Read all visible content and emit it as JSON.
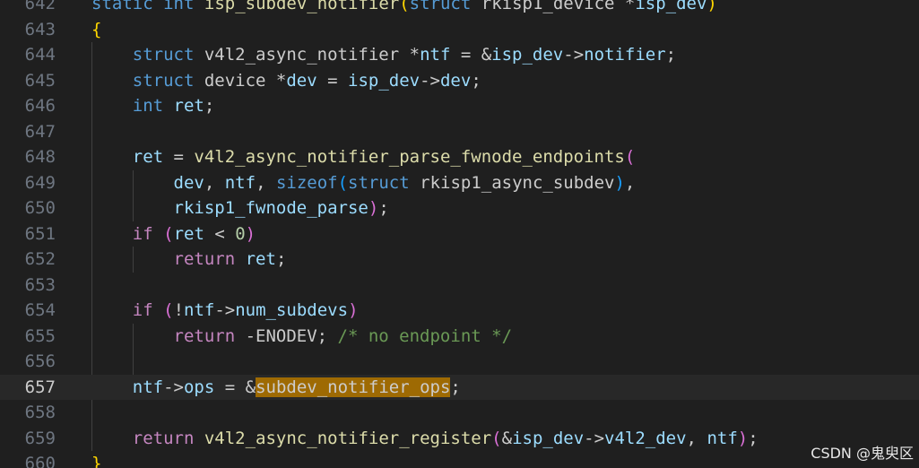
{
  "editor": {
    "current_line": "657",
    "lines": [
      {
        "num": "642",
        "tokens": [
          {
            "t": "kw",
            "v": "static"
          },
          {
            "t": "plain",
            "v": " "
          },
          {
            "t": "kw",
            "v": "int"
          },
          {
            "t": "plain",
            "v": " "
          },
          {
            "t": "fn",
            "v": "isp_subdev_notifier"
          },
          {
            "t": "b1",
            "v": "("
          },
          {
            "t": "kw",
            "v": "struct"
          },
          {
            "t": "plain",
            "v": " rkisp1_device *"
          },
          {
            "t": "var",
            "v": "isp_dev"
          },
          {
            "t": "b1",
            "v": ")"
          }
        ]
      },
      {
        "num": "643",
        "tokens": [
          {
            "t": "b1",
            "v": "{"
          }
        ]
      },
      {
        "num": "644",
        "tokens": [
          {
            "t": "plain",
            "v": "    "
          },
          {
            "t": "kw",
            "v": "struct"
          },
          {
            "t": "plain",
            "v": " v4l2_async_notifier *"
          },
          {
            "t": "var",
            "v": "ntf"
          },
          {
            "t": "plain",
            "v": " = &"
          },
          {
            "t": "var",
            "v": "isp_dev"
          },
          {
            "t": "plain",
            "v": "->"
          },
          {
            "t": "prop",
            "v": "notifier"
          },
          {
            "t": "plain",
            "v": ";"
          }
        ]
      },
      {
        "num": "645",
        "tokens": [
          {
            "t": "plain",
            "v": "    "
          },
          {
            "t": "kw",
            "v": "struct"
          },
          {
            "t": "plain",
            "v": " device *"
          },
          {
            "t": "var",
            "v": "dev"
          },
          {
            "t": "plain",
            "v": " = "
          },
          {
            "t": "var",
            "v": "isp_dev"
          },
          {
            "t": "plain",
            "v": "->"
          },
          {
            "t": "prop",
            "v": "dev"
          },
          {
            "t": "plain",
            "v": ";"
          }
        ]
      },
      {
        "num": "646",
        "tokens": [
          {
            "t": "plain",
            "v": "    "
          },
          {
            "t": "kw",
            "v": "int"
          },
          {
            "t": "plain",
            "v": " "
          },
          {
            "t": "var",
            "v": "ret"
          },
          {
            "t": "plain",
            "v": ";"
          }
        ]
      },
      {
        "num": "647",
        "tokens": []
      },
      {
        "num": "648",
        "tokens": [
          {
            "t": "plain",
            "v": "    "
          },
          {
            "t": "var",
            "v": "ret"
          },
          {
            "t": "plain",
            "v": " = "
          },
          {
            "t": "fn",
            "v": "v4l2_async_notifier_parse_fwnode_endpoints"
          },
          {
            "t": "b2",
            "v": "("
          }
        ]
      },
      {
        "num": "649",
        "tokens": [
          {
            "t": "plain",
            "v": "        "
          },
          {
            "t": "var",
            "v": "dev"
          },
          {
            "t": "plain",
            "v": ", "
          },
          {
            "t": "var",
            "v": "ntf"
          },
          {
            "t": "plain",
            "v": ", "
          },
          {
            "t": "kw",
            "v": "sizeof"
          },
          {
            "t": "b3",
            "v": "("
          },
          {
            "t": "kw",
            "v": "struct"
          },
          {
            "t": "plain",
            "v": " rkisp1_async_subdev"
          },
          {
            "t": "b3",
            "v": ")"
          },
          {
            "t": "plain",
            "v": ","
          }
        ]
      },
      {
        "num": "650",
        "tokens": [
          {
            "t": "plain",
            "v": "        "
          },
          {
            "t": "var",
            "v": "rkisp1_fwnode_parse"
          },
          {
            "t": "b2",
            "v": ")"
          },
          {
            "t": "plain",
            "v": ";"
          }
        ]
      },
      {
        "num": "651",
        "tokens": [
          {
            "t": "plain",
            "v": "    "
          },
          {
            "t": "ctrl",
            "v": "if"
          },
          {
            "t": "plain",
            "v": " "
          },
          {
            "t": "b2",
            "v": "("
          },
          {
            "t": "var",
            "v": "ret"
          },
          {
            "t": "plain",
            "v": " < "
          },
          {
            "t": "num",
            "v": "0"
          },
          {
            "t": "b2",
            "v": ")"
          }
        ]
      },
      {
        "num": "652",
        "tokens": [
          {
            "t": "plain",
            "v": "        "
          },
          {
            "t": "ctrl",
            "v": "return"
          },
          {
            "t": "plain",
            "v": " "
          },
          {
            "t": "var",
            "v": "ret"
          },
          {
            "t": "plain",
            "v": ";"
          }
        ]
      },
      {
        "num": "653",
        "tokens": []
      },
      {
        "num": "654",
        "tokens": [
          {
            "t": "plain",
            "v": "    "
          },
          {
            "t": "ctrl",
            "v": "if"
          },
          {
            "t": "plain",
            "v": " "
          },
          {
            "t": "b2",
            "v": "("
          },
          {
            "t": "plain",
            "v": "!"
          },
          {
            "t": "var",
            "v": "ntf"
          },
          {
            "t": "plain",
            "v": "->"
          },
          {
            "t": "prop",
            "v": "num_subdevs"
          },
          {
            "t": "b2",
            "v": ")"
          }
        ]
      },
      {
        "num": "655",
        "tokens": [
          {
            "t": "plain",
            "v": "        "
          },
          {
            "t": "ctrl",
            "v": "return"
          },
          {
            "t": "plain",
            "v": " -ENODEV; "
          },
          {
            "t": "cmt",
            "v": "/* no endpoint */"
          }
        ]
      },
      {
        "num": "656",
        "tokens": []
      },
      {
        "num": "657",
        "tokens": [
          {
            "t": "plain",
            "v": "    "
          },
          {
            "t": "var",
            "v": "ntf"
          },
          {
            "t": "plain",
            "v": "->"
          },
          {
            "t": "prop",
            "v": "ops"
          },
          {
            "t": "plain",
            "v": " = &"
          },
          {
            "t": "hl",
            "v": "subdev_notifier_ops"
          },
          {
            "t": "plain",
            "v": ";"
          }
        ]
      },
      {
        "num": "658",
        "tokens": []
      },
      {
        "num": "659",
        "tokens": [
          {
            "t": "plain",
            "v": "    "
          },
          {
            "t": "ctrl",
            "v": "return"
          },
          {
            "t": "plain",
            "v": " "
          },
          {
            "t": "fn",
            "v": "v4l2_async_notifier_register"
          },
          {
            "t": "b2",
            "v": "("
          },
          {
            "t": "plain",
            "v": "&"
          },
          {
            "t": "var",
            "v": "isp_dev"
          },
          {
            "t": "plain",
            "v": "->"
          },
          {
            "t": "prop",
            "v": "v4l2_dev"
          },
          {
            "t": "plain",
            "v": ", "
          },
          {
            "t": "var",
            "v": "ntf"
          },
          {
            "t": "b2",
            "v": ")"
          },
          {
            "t": "plain",
            "v": ";"
          }
        ]
      },
      {
        "num": "660",
        "tokens": [
          {
            "t": "b1",
            "v": "}"
          }
        ]
      }
    ]
  },
  "watermark": "CSDN @鬼臾区",
  "colors": {
    "background": "#1f1f1f",
    "current_line_bg": "#282828",
    "line_number": "#6e7681",
    "keyword": "#569cd6",
    "control": "#c586c0",
    "function": "#dcdcaa",
    "variable": "#9cdcfe",
    "comment": "#6a9955",
    "number": "#b5cea8",
    "highlight": "#9e6a03"
  }
}
